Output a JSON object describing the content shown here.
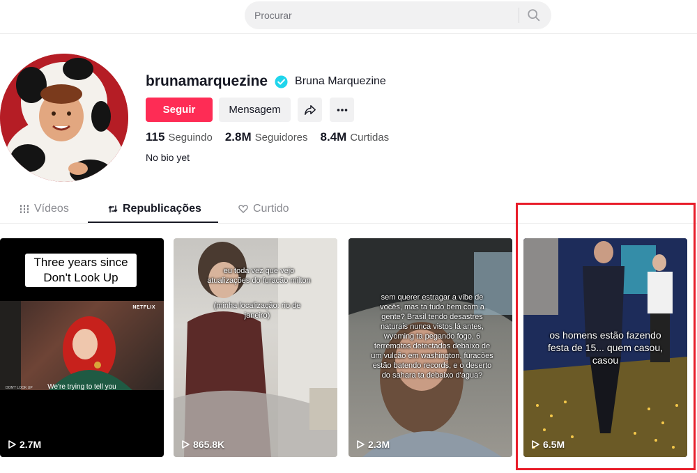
{
  "search": {
    "placeholder": "Procurar"
  },
  "profile": {
    "username": "brunamarquezine",
    "display_name": "Bruna Marquezine",
    "verified": true,
    "follow_label": "Seguir",
    "message_label": "Mensagem",
    "stats": {
      "following_count": "115",
      "following_label": "Seguindo",
      "followers_count": "2.8M",
      "followers_label": "Seguidores",
      "likes_count": "8.4M",
      "likes_label": "Curtidas"
    },
    "bio": "No bio yet"
  },
  "tabs": [
    {
      "label": "Vídeos",
      "icon": "grid-icon",
      "active": false
    },
    {
      "label": "Republicações",
      "icon": "repost-icon",
      "active": true
    },
    {
      "label": "Curtido",
      "icon": "heart-icon",
      "active": false
    }
  ],
  "videos": [
    {
      "views": "2.7M",
      "caption": "Three years since Don't Look Up",
      "subtitle": "We're trying to tell you",
      "badge": "NETFLIX",
      "small_text": "DON'T LOOK UP"
    },
    {
      "views": "865.8K",
      "overlay_1": "eu toda vez que vejo atualizações do furacão milton",
      "overlay_2": "(minha localização: rio de janeiro)"
    },
    {
      "views": "2.3M",
      "overlay": "sem querer estragar a vibe de vocês, mas ta tudo bem com a gente? Brasil tendo desastres naturais nunca vistos lá antes, wyoming ta pegando fogo, 6 terremotos detectados debaixo de um vulcão em washington, furacões estão batendo records, e o deserto do sahara ta debaixo d'agua?"
    },
    {
      "views": "6.5M",
      "overlay": "os homens estão fazendo festa de 15... quem casou, casou",
      "highlighted": true
    }
  ],
  "colors": {
    "accent": "#fe2c55",
    "verified": "#20d5ec",
    "highlight": "#e81d2a"
  }
}
